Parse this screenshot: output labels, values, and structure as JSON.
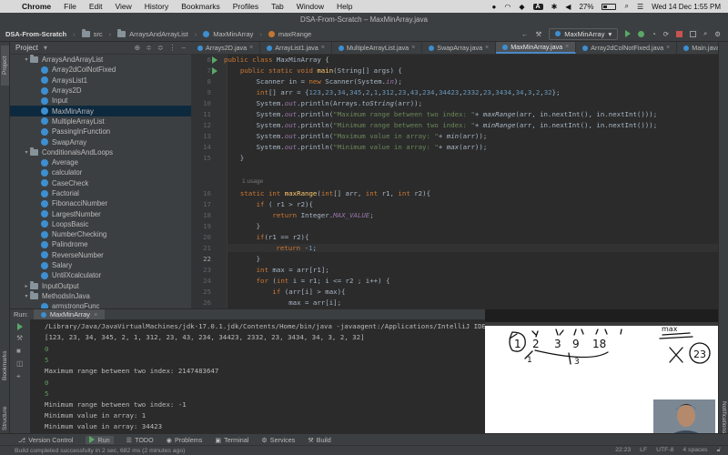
{
  "menubar": {
    "app": "Chrome",
    "items": [
      "File",
      "Edit",
      "View",
      "History",
      "Bookmarks",
      "Profiles",
      "Tab",
      "Window",
      "Help"
    ],
    "badge": "A",
    "battery": "27%",
    "datetime": "Wed 14 Dec  1:55 PM"
  },
  "window_title": "DSA-From-Scratch – MaxMinArray.java",
  "breadcrumb": [
    "DSA-From-Scratch",
    "src",
    "ArraysAndArrayList",
    "MaxMinArray",
    "maxRange"
  ],
  "run_config": "MaxMinArray",
  "project_panel": {
    "title": "Project",
    "tree": [
      {
        "label": "ArraysAndArrayList",
        "type": "folder",
        "indent": 1,
        "arrow": "▾"
      },
      {
        "label": "Array2dColNotFixed",
        "type": "class",
        "indent": 2
      },
      {
        "label": "ArraysList1",
        "type": "class",
        "indent": 2
      },
      {
        "label": "Arrays2D",
        "type": "class",
        "indent": 2
      },
      {
        "label": "Input",
        "type": "class",
        "indent": 2
      },
      {
        "label": "MaxMinArray",
        "type": "class",
        "indent": 2,
        "selected": true
      },
      {
        "label": "MultipleArrayList",
        "type": "class",
        "indent": 2
      },
      {
        "label": "PassingInFunction",
        "type": "class",
        "indent": 2
      },
      {
        "label": "SwapArray",
        "type": "class",
        "indent": 2
      },
      {
        "label": "ConditionalsAndLoops",
        "type": "folder",
        "indent": 1,
        "arrow": "▾"
      },
      {
        "label": "Average",
        "type": "class",
        "indent": 2
      },
      {
        "label": "calculator",
        "type": "class",
        "indent": 2
      },
      {
        "label": "CaseCheck",
        "type": "class",
        "indent": 2
      },
      {
        "label": "Factorial",
        "type": "class",
        "indent": 2
      },
      {
        "label": "FibonacciNumber",
        "type": "class",
        "indent": 2
      },
      {
        "label": "LargestNumber",
        "type": "class",
        "indent": 2
      },
      {
        "label": "LoopsBasic",
        "type": "class",
        "indent": 2
      },
      {
        "label": "NumberChecking",
        "type": "class",
        "indent": 2
      },
      {
        "label": "Palindrome",
        "type": "class",
        "indent": 2
      },
      {
        "label": "ReverseNumber",
        "type": "class",
        "indent": 2
      },
      {
        "label": "Salary",
        "type": "class",
        "indent": 2
      },
      {
        "label": "UntilXcalculator",
        "type": "class",
        "indent": 2
      },
      {
        "label": "InputOutput",
        "type": "folder",
        "indent": 1,
        "arrow": "▸"
      },
      {
        "label": "MethodsInJava",
        "type": "folder",
        "indent": 1,
        "arrow": "▾"
      },
      {
        "label": "armstrongFunc",
        "type": "class",
        "indent": 2
      }
    ]
  },
  "editor_tabs": [
    {
      "label": "Arrays2D.java",
      "active": false
    },
    {
      "label": "ArrayList1.java",
      "active": false
    },
    {
      "label": "MultipleArrayList.java",
      "active": false
    },
    {
      "label": "SwapArray.java",
      "active": false
    },
    {
      "label": "MaxMinArray.java",
      "active": true
    },
    {
      "label": "Array2dColNotFixed.java",
      "active": false
    },
    {
      "label": "Main.java",
      "active": false
    }
  ],
  "code": {
    "line_numbers": [
      "6",
      "7",
      "8",
      "9",
      "10",
      "11",
      "12",
      "13",
      "14",
      "15",
      "",
      "16",
      "17",
      "18",
      "19",
      "20",
      "21",
      "22",
      "23",
      "24",
      "25",
      "26",
      "27"
    ],
    "usage_hint": "1 usage",
    "current_line": "22"
  },
  "left_tabs": [
    "Project",
    "Bookmarks",
    "Structure"
  ],
  "right_tabs": [
    "Notifications"
  ],
  "run_panel": {
    "label": "Run:",
    "tab": "MaxMinArray",
    "console": [
      {
        "text": "/Library/Java/JavaVirtualMachines/jdk-17.0.1.jdk/Contents/Home/bin/java -javaagent:/Applications/IntelliJ IDE",
        "kind": "path"
      },
      {
        "text": "[123, 23, 34, 345, 2, 1, 312, 23, 43, 234, 34423, 2332, 23, 3434, 34, 3, 2, 32]",
        "kind": "out"
      },
      {
        "text": "0",
        "kind": "inp"
      },
      {
        "text": "5",
        "kind": "inp"
      },
      {
        "text": "Maximum range between two index: 2147483647",
        "kind": "out"
      },
      {
        "text": "0",
        "kind": "inp"
      },
      {
        "text": "5",
        "kind": "inp"
      },
      {
        "text": "Minimum range between two index: -1",
        "kind": "out"
      },
      {
        "text": "Minimum value in array: 1",
        "kind": "out"
      },
      {
        "text": "Minimum value in array: 34423",
        "kind": "out"
      }
    ]
  },
  "bottom_tools": [
    "Version Control",
    "Run",
    "TODO",
    "Problems",
    "Terminal",
    "Services",
    "Build"
  ],
  "status": {
    "message": "Build completed successfully in 2 sec, 682 ms (2 minutes ago)",
    "right": [
      "22:23",
      "LF",
      "UTF-8",
      "4 spaces"
    ]
  },
  "video_overlay": {
    "handwriting": [
      "1",
      "2",
      "3",
      "9",
      "18",
      "1",
      "3",
      "max",
      "23"
    ]
  }
}
